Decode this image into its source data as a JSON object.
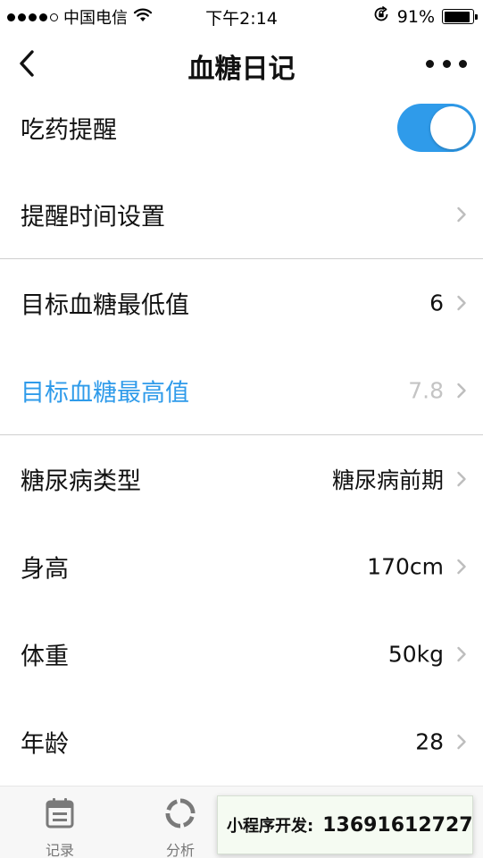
{
  "status_bar": {
    "carrier": "中国电信",
    "time": "下午2:14",
    "battery_text": "91%",
    "battery_level": 0.91,
    "icons": [
      "signal-dots",
      "wifi-icon",
      "rotation-lock-icon",
      "battery-icon"
    ]
  },
  "nav": {
    "title": "血糖日记",
    "back_icon": "chevron-left-icon",
    "more_icon": "more-icon"
  },
  "settings": {
    "reminder": {
      "label": "吃药提醒",
      "enabled": true
    },
    "reminder_time": {
      "label": "提醒时间设置"
    },
    "target_min": {
      "label": "目标血糖最低值",
      "value": "6"
    },
    "target_max": {
      "label": "目标血糖最高值",
      "value": "7.8"
    },
    "diabetes_type": {
      "label": "糖尿病类型",
      "value": "糖尿病前期"
    },
    "height": {
      "label": "身高",
      "value": "170cm"
    },
    "weight": {
      "label": "体重",
      "value": "50kg"
    },
    "age": {
      "label": "年龄",
      "value": "28"
    }
  },
  "tabs": [
    {
      "label": "记录",
      "icon": "calendar-icon"
    },
    {
      "label": "分析",
      "icon": "ring-chart-icon"
    }
  ],
  "dev_banner": {
    "label": "小程序开发:",
    "phone": "13691612727"
  },
  "colors": {
    "accent": "#2f9bea",
    "muted_value": "#c4c4c4",
    "divider": "#cfcfcf",
    "tab_bar_bg": "#f7f7f7"
  }
}
